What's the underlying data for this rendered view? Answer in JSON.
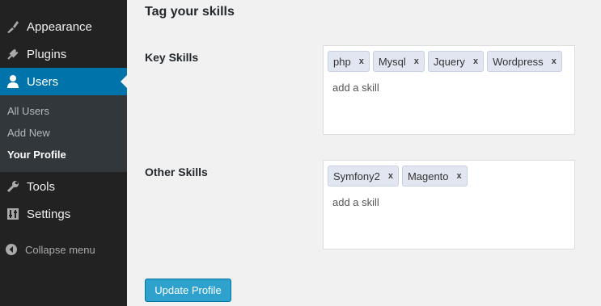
{
  "sidebar": {
    "items": [
      {
        "label": "Appearance",
        "icon": "paintbrush-icon"
      },
      {
        "label": "Plugins",
        "icon": "plug-icon"
      },
      {
        "label": "Users",
        "icon": "user-icon"
      },
      {
        "label": "Tools",
        "icon": "wrench-icon"
      },
      {
        "label": "Settings",
        "icon": "settings-icon"
      }
    ],
    "submenu": [
      "All Users",
      "Add New",
      "Your Profile"
    ],
    "collapse_label": "Collapse menu"
  },
  "main": {
    "section_title": "Tag your skills",
    "fields": [
      {
        "label": "Key Skills",
        "tags": [
          "php",
          "Mysql",
          "Jquery",
          "Wordpress"
        ],
        "placeholder": "add a skill"
      },
      {
        "label": "Other Skills",
        "tags": [
          "Symfony2",
          "Magento"
        ],
        "placeholder": "add a skill"
      }
    ],
    "remove_glyph": "x",
    "submit_label": "Update Profile"
  },
  "colors": {
    "sidebar_bg": "#222222",
    "active_bg": "#0073aa",
    "button_bg": "#2ea2cc",
    "tag_bg": "#e2e6f0"
  }
}
